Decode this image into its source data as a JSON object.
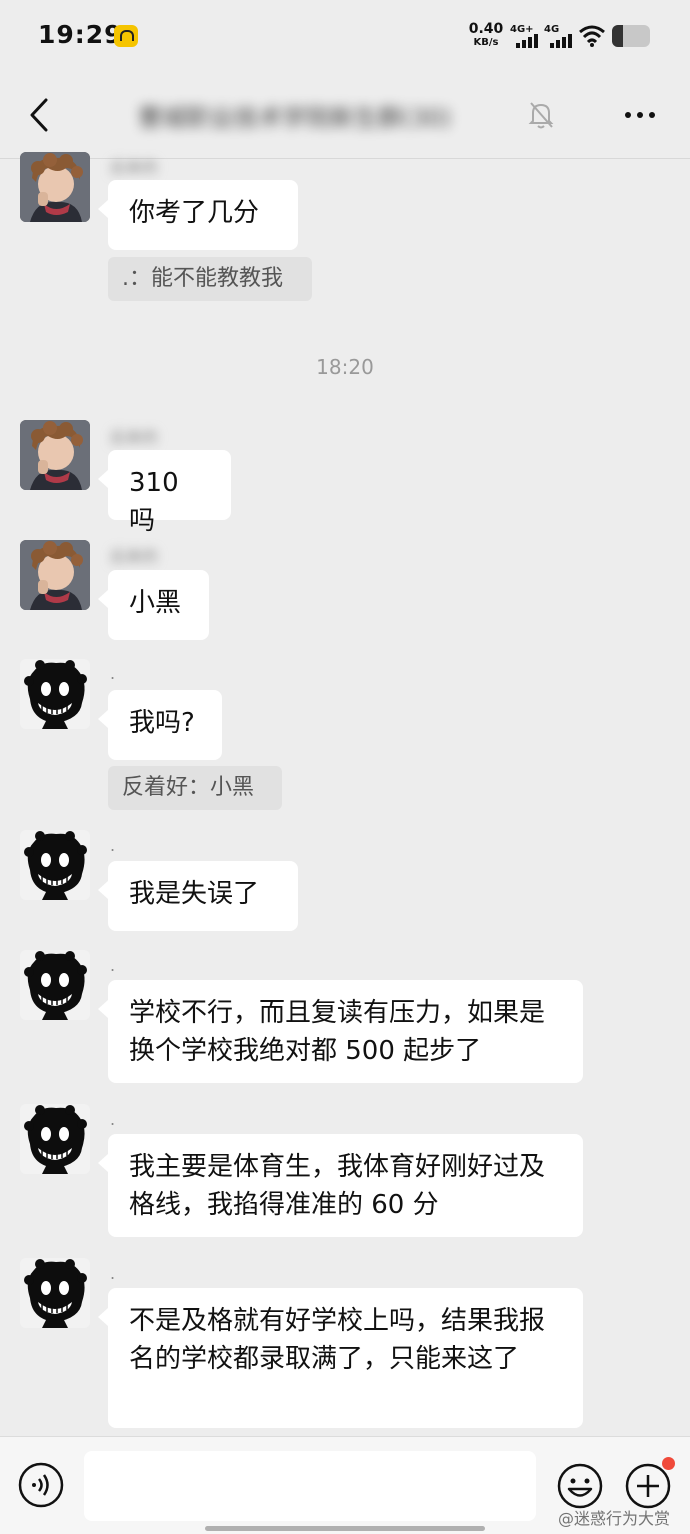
{
  "status_bar": {
    "time": "19:29",
    "net_speed_value": "0.40",
    "net_speed_unit": "KB/s",
    "signal1_label": "4G+",
    "signal2_label": "4G",
    "battery_level": 0.3
  },
  "header": {
    "title": "曹城职业技术学院新生群(30)"
  },
  "messages": [
    {
      "sender": "后来的",
      "text": "你考了几分",
      "quote": ".：能不能教教我"
    },
    {
      "sender": "后来的",
      "text": "310 吗"
    },
    {
      "sender": "后来的",
      "text": "小黑"
    },
    {
      "sender": ".",
      "text": "我吗?",
      "quote": "反着好：小黑"
    },
    {
      "sender": ".",
      "text": "我是失误了"
    },
    {
      "sender": ".",
      "text": "学校不行，而且复读有压力，如果是换个学校我绝对都 500 起步了"
    },
    {
      "sender": ".",
      "text": "我主要是体育生，我体育好刚好过及格线，我掐得准准的 60 分"
    },
    {
      "sender": ".",
      "text": "不是及格就有好学校上吗，结果我报名的学校都录取满了，只能来这了"
    }
  ],
  "timestamp": "18:20",
  "watermark": "@迷惑行为大赏",
  "colors": {
    "background": "#ededed",
    "bubble": "#ffffff",
    "quote": "#e1e1e1",
    "badge": "#f04a3a"
  }
}
